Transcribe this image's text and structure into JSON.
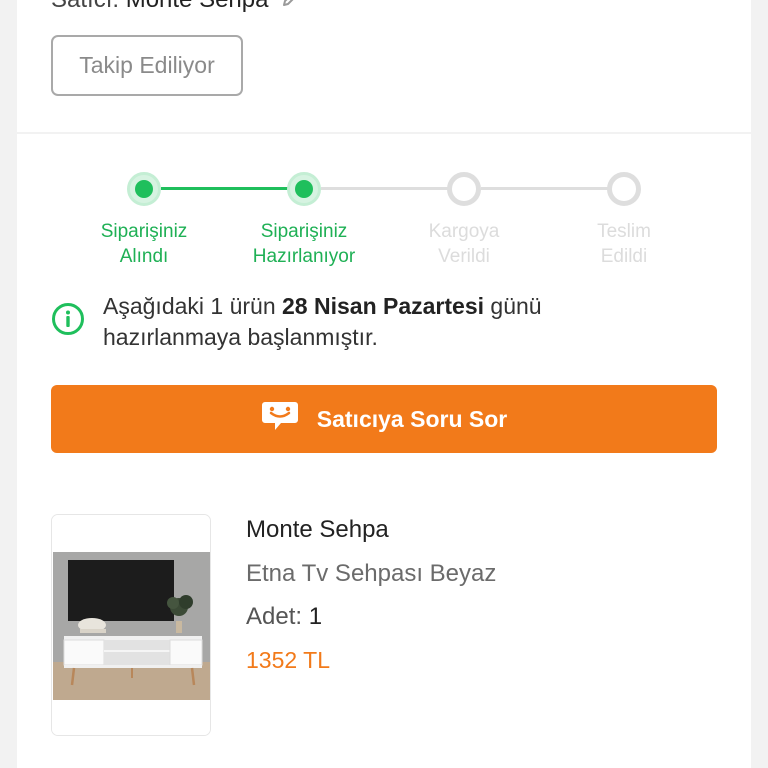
{
  "seller": {
    "label": "Satıcı:",
    "name": "Monte Sehpa",
    "follow_label": "Takip Ediliyor"
  },
  "tracker": {
    "steps": [
      {
        "line1": "Siparişiniz",
        "line2": "Alındı",
        "state": "done"
      },
      {
        "line1": "Siparişiniz",
        "line2": "Hazırlanıyor",
        "state": "done"
      },
      {
        "line1": "Kargoya",
        "line2": "Verildi",
        "state": "todo"
      },
      {
        "line1": "Teslim",
        "line2": "Edildi",
        "state": "todo"
      }
    ],
    "active_color": "#1fbf5c",
    "inactive_color": "#dedede"
  },
  "notice": {
    "prefix": "Aşağıdaki 1 ürün",
    "date": "28 Nisan Pazartesi",
    "suffix_line1": "günü",
    "line2": "hazırlanmaya başlanmıştır.",
    "icon": "info-circle-icon"
  },
  "ask_seller": {
    "label": "Satıcıya Soru Sor",
    "icon": "chat-smile-icon",
    "color": "#f27a1a"
  },
  "product": {
    "seller": "Monte Sehpa",
    "name": "Etna Tv Sehpası Beyaz",
    "qty_label": "Adet:",
    "qty_value": "1",
    "price": "1352 TL",
    "price_color": "#f27a1a"
  }
}
